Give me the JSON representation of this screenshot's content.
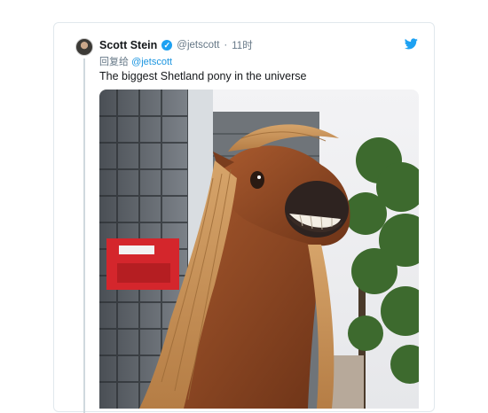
{
  "tweet": {
    "author_name": "Scott Stein",
    "verified_glyph": "✓",
    "author_handle": "@jetscott",
    "separator": "·",
    "timestamp": "11时",
    "reply_prefix": "回复给",
    "reply_handle": "@jetscott",
    "text": "The biggest Shetland pony in the universe",
    "avatar_icon": "avatar",
    "brand_icon": "twitter-bird-icon",
    "brand_color": "#1da1f2"
  },
  "media": {
    "alt": "AR Shetland pony in front of construction site"
  }
}
